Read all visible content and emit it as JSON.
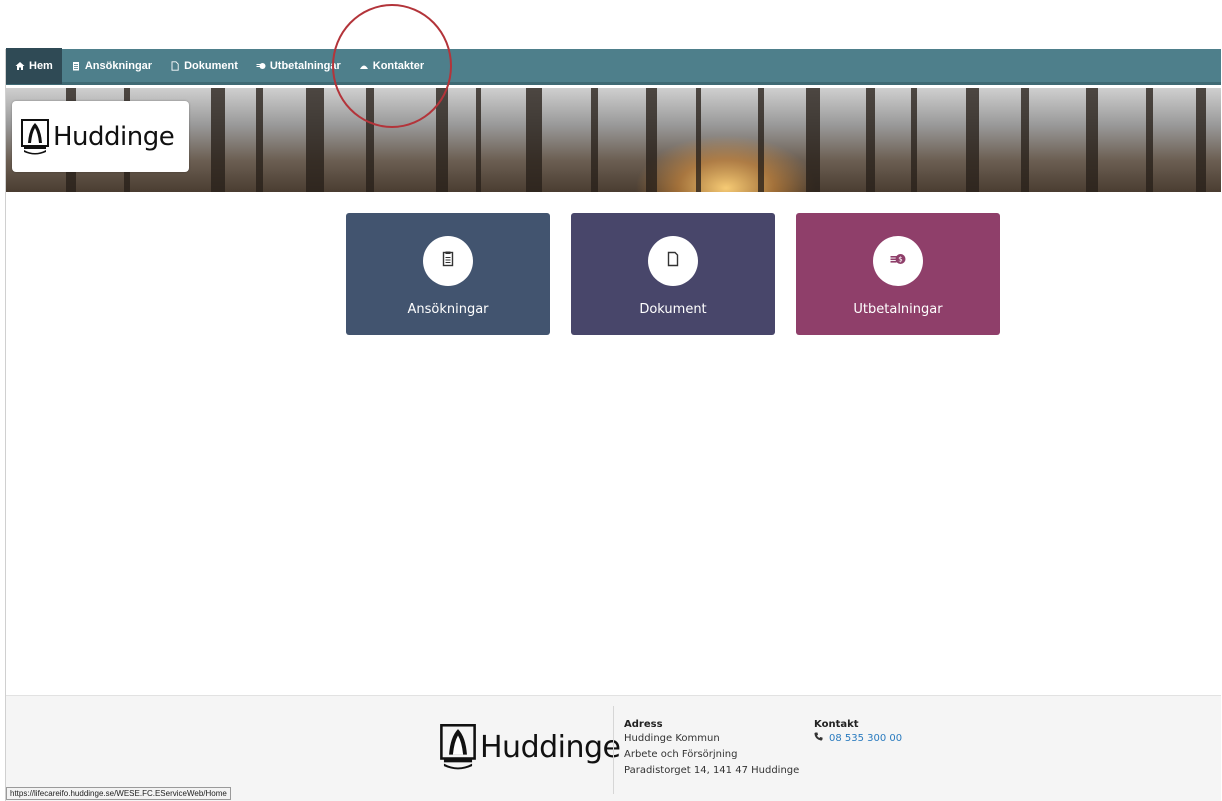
{
  "nav": {
    "items": [
      {
        "label": "Hem",
        "icon": "home-icon",
        "active": true
      },
      {
        "label": "Ansökningar",
        "icon": "clipboard-icon",
        "active": false
      },
      {
        "label": "Dokument",
        "icon": "document-icon",
        "active": false
      },
      {
        "label": "Utbetalningar",
        "icon": "money-icon",
        "active": false
      },
      {
        "label": "Kontakter",
        "icon": "contacts-icon",
        "active": false
      }
    ]
  },
  "header": {
    "logo_text": "Huddinge"
  },
  "tiles": [
    {
      "label": "Ansökningar",
      "icon": "clipboard-icon",
      "color": "#42546f"
    },
    {
      "label": "Dokument",
      "icon": "document-icon",
      "color": "#48466a"
    },
    {
      "label": "Utbetalningar",
      "icon": "money-icon",
      "color": "#8f3f6a"
    }
  ],
  "footer": {
    "logo_text": "Huddinge",
    "address": {
      "title": "Adress",
      "lines": [
        "Huddinge Kommun",
        "Arbete och Försörjning",
        "Paradistorget 14, 141 47 Huddinge"
      ]
    },
    "contact": {
      "title": "Kontakt",
      "phone": "08 535 300 00"
    }
  },
  "status_url": "https://lifecareifo.huddinge.se/WESE.FC.EServiceWeb/Home",
  "colors": {
    "navbar": "#4e7f8b",
    "nav_active": "#2f4a55",
    "annotation": "#b3343a",
    "link": "#2a7bbf"
  }
}
